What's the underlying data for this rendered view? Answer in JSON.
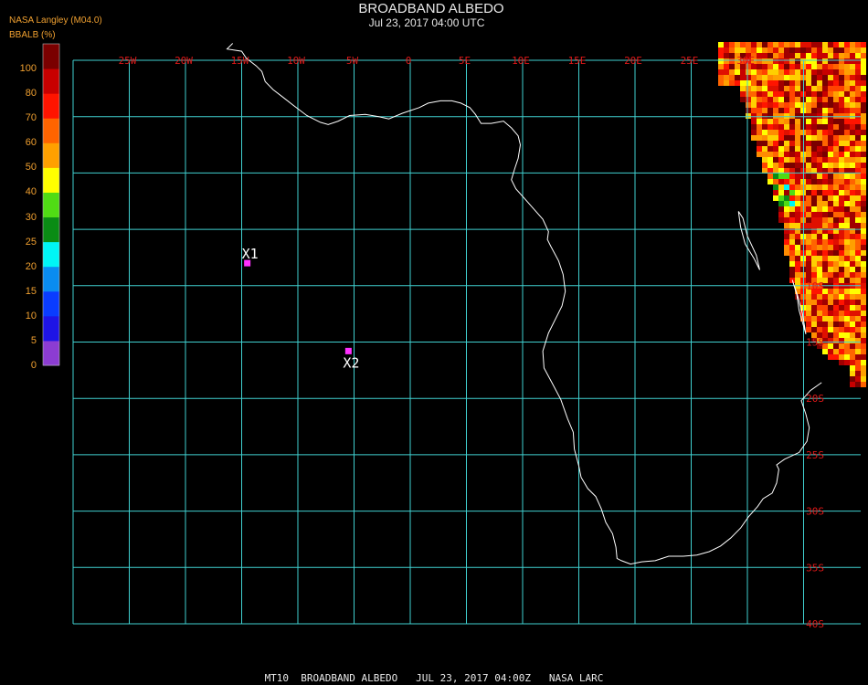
{
  "header": {
    "title": "BROADBAND ALBEDO",
    "subtitle": "Jul 23, 2017 04:00 UTC",
    "source": "NASA Langley (M04.0)"
  },
  "colorbar": {
    "title": "BBALB (%)",
    "bins": [
      {
        "lo": 0,
        "hi": 5,
        "color": "#8c3cd2"
      },
      {
        "lo": 5,
        "hi": 10,
        "color": "#1e14e6"
      },
      {
        "lo": 10,
        "hi": 15,
        "color": "#0a3cff"
      },
      {
        "lo": 15,
        "hi": 20,
        "color": "#0a8cf0"
      },
      {
        "lo": 20,
        "hi": 25,
        "color": "#00f5f5"
      },
      {
        "lo": 25,
        "hi": 30,
        "color": "#0a8c14"
      },
      {
        "lo": 30,
        "hi": 40,
        "color": "#50dc14"
      },
      {
        "lo": 40,
        "hi": 50,
        "color": "#ffff00"
      },
      {
        "lo": 50,
        "hi": 60,
        "color": "#ffa000"
      },
      {
        "lo": 60,
        "hi": 70,
        "color": "#ff6400"
      },
      {
        "lo": 70,
        "hi": 80,
        "color": "#ff1400"
      },
      {
        "lo": 80,
        "hi": 90,
        "color": "#c80000"
      },
      {
        "lo": 90,
        "hi": 100,
        "color": "#7a0000"
      }
    ],
    "labels": [
      "0",
      "5",
      "10",
      "15",
      "20",
      "25",
      "30",
      "40",
      "50",
      "60",
      "70",
      "80",
      "100"
    ]
  },
  "map": {
    "lon_min": -30,
    "lon_max": 35,
    "lat_min": -40,
    "lat_max": 10,
    "grid_color": "#40d0d0",
    "coast_color": "#ffffff",
    "label_color": "#e01818",
    "lon_labels": [
      {
        "lon": -25,
        "text": "25W"
      },
      {
        "lon": -20,
        "text": "20W"
      },
      {
        "lon": -15,
        "text": "15W"
      },
      {
        "lon": -10,
        "text": "10W"
      },
      {
        "lon": -5,
        "text": "5W"
      },
      {
        "lon": 0,
        "text": "0"
      },
      {
        "lon": 5,
        "text": "5E"
      },
      {
        "lon": 10,
        "text": "10E"
      },
      {
        "lon": 15,
        "text": "15E"
      },
      {
        "lon": 20,
        "text": "20E"
      },
      {
        "lon": 25,
        "text": "25E"
      },
      {
        "lon": 30,
        "text": "30E"
      }
    ],
    "lat_labels": [
      {
        "lat": -10,
        "text": "10S"
      },
      {
        "lat": -15,
        "text": "15S"
      },
      {
        "lat": -20,
        "text": "20S"
      },
      {
        "lat": -25,
        "text": "25S"
      },
      {
        "lat": -30,
        "text": "30S"
      },
      {
        "lat": -35,
        "text": "35S"
      },
      {
        "lat": -40,
        "text": "40S"
      }
    ],
    "markers": [
      {
        "label": "X1",
        "lon": -14.5,
        "lat": -8.0,
        "color": "#ff30ff",
        "label_pos": "above"
      },
      {
        "label": "X2",
        "lon": -5.5,
        "lat": -15.8,
        "color": "#ff30ff",
        "label_pos": "below"
      }
    ]
  },
  "footer": "MT10  BROADBAND ALBEDO   JUL 23, 2017 04:00Z   NASA LARC"
}
